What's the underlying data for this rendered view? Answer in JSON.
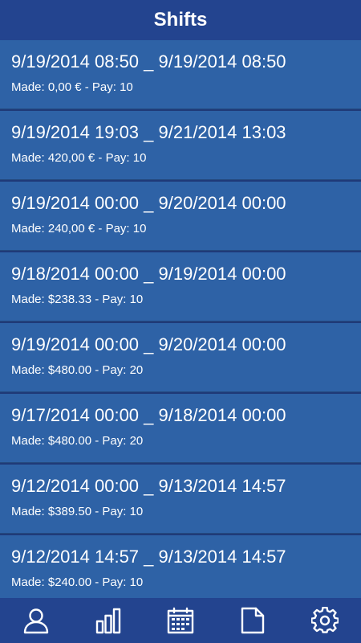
{
  "header": {
    "title": "Shifts"
  },
  "shifts": [
    {
      "range": "9/19/2014 08:50 _ 9/19/2014 08:50",
      "meta": "Made: 0,00 € - Pay: 10"
    },
    {
      "range": "9/19/2014 19:03 _ 9/21/2014 13:03",
      "meta": "Made: 420,00 € - Pay: 10"
    },
    {
      "range": "9/19/2014 00:00 _ 9/20/2014 00:00",
      "meta": "Made: 240,00 € - Pay: 10"
    },
    {
      "range": "9/18/2014 00:00 _ 9/19/2014 00:00",
      "meta": "Made: $238.33 - Pay: 10"
    },
    {
      "range": "9/19/2014 00:00 _ 9/20/2014 00:00",
      "meta": "Made: $480.00 - Pay: 20"
    },
    {
      "range": "9/17/2014 00:00 _ 9/18/2014 00:00",
      "meta": "Made: $480.00 - Pay: 20"
    },
    {
      "range": "9/12/2014 00:00 _ 9/13/2014 14:57",
      "meta": "Made: $389.50 - Pay: 10"
    },
    {
      "range": "9/12/2014 14:57 _ 9/13/2014 14:57",
      "meta": "Made: $240.00 - Pay: 10"
    }
  ],
  "bottom_nav": {
    "items": [
      {
        "icon": "person-icon"
      },
      {
        "icon": "bar-chart-icon"
      },
      {
        "icon": "calendar-icon"
      },
      {
        "icon": "document-icon"
      },
      {
        "icon": "gear-icon"
      }
    ]
  },
  "colors": {
    "header": "#23448f",
    "list_item": "#2e62a6",
    "text": "#ffffff"
  }
}
